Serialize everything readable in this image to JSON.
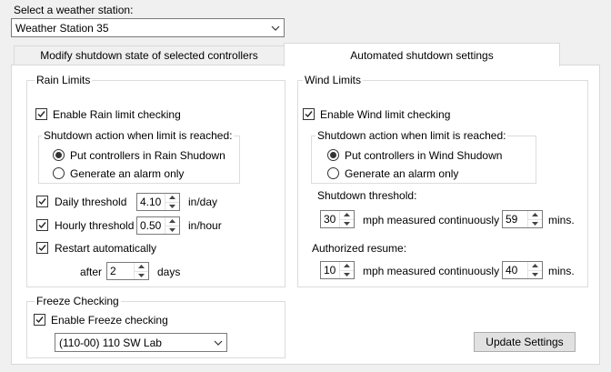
{
  "station": {
    "label": "Select a weather station:",
    "selected": "Weather Station 35"
  },
  "tabs": [
    {
      "label": "Modify shutdown state of selected controllers"
    },
    {
      "label": "Automated shutdown settings"
    }
  ],
  "rain": {
    "title": "Rain Limits",
    "enable_label": "Enable Rain limit checking",
    "enable_checked": true,
    "action_title": "Shutdown action when limit is reached:",
    "action_options": [
      {
        "label": "Put controllers in Rain Shudown",
        "selected": true
      },
      {
        "label": "Generate an alarm only",
        "selected": false
      }
    ],
    "daily": {
      "label": "Daily threshold",
      "value": "4.10",
      "unit": "in/day",
      "checked": true
    },
    "hourly": {
      "label": "Hourly threshold",
      "value": "0.50",
      "unit": "in/hour",
      "checked": true
    },
    "restart": {
      "label": "Restart automatically",
      "checked": true,
      "after_label": "after",
      "value": "2",
      "unit": "days"
    }
  },
  "wind": {
    "title": "Wind Limits",
    "enable_label": "Enable Wind limit checking",
    "enable_checked": true,
    "action_title": "Shutdown action when limit is reached:",
    "action_options": [
      {
        "label": "Put controllers in Wind Shudown",
        "selected": true
      },
      {
        "label": "Generate an alarm only",
        "selected": false
      }
    ],
    "threshold_label": "Shutdown threshold:",
    "threshold_speed": "30",
    "threshold_mid": "mph measured continuously for",
    "threshold_time": "59",
    "threshold_unit": "mins.",
    "resume_label": "Authorized resume:",
    "resume_speed": "10",
    "resume_mid": "mph measured continuously for",
    "resume_time": "40",
    "resume_unit": "mins."
  },
  "freeze": {
    "title": "Freeze Checking",
    "enable_label": "Enable Freeze checking",
    "enable_checked": true,
    "selected": "(110-00) 110 SW Lab"
  },
  "update_button": "Update Settings"
}
